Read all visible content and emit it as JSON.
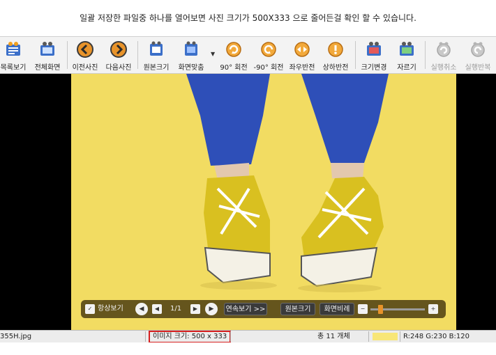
{
  "caption": "일괄 저장한 파일중 하나를 열어보면  사진 크기가  500X333 으로 줄어든걸 확인 할 수 있습니다.",
  "toolbar": {
    "buttons": [
      {
        "label": "목록보기",
        "icon": "list-view-icon"
      },
      {
        "label": "전체화면",
        "icon": "fullscreen-icon"
      },
      {
        "label": "이전사진",
        "icon": "previous-arrow-icon"
      },
      {
        "label": "다음사진",
        "icon": "next-arrow-icon"
      },
      {
        "label": "원본크기",
        "icon": "original-size-icon"
      },
      {
        "label": "화면맞춤",
        "icon": "fit-screen-icon"
      },
      {
        "label": "90° 회전",
        "icon": "rotate-cw-icon"
      },
      {
        "label": "-90° 회전",
        "icon": "rotate-ccw-icon"
      },
      {
        "label": "좌우반전",
        "icon": "flip-horizontal-icon"
      },
      {
        "label": "상하반전",
        "icon": "flip-vertical-icon"
      },
      {
        "label": "크기변경",
        "icon": "resize-icon"
      },
      {
        "label": "자르기",
        "icon": "crop-icon"
      },
      {
        "label": "실행취소",
        "icon": "undo-icon"
      },
      {
        "label": "실행반복",
        "icon": "redo-icon"
      }
    ]
  },
  "controlbar": {
    "always_view_label": "항상보기",
    "page_indicator": "1/1",
    "slideshow_label": "연속보기 >>",
    "original_size_label": "원본크기",
    "screen_ratio_label": "화면비례",
    "minus": "−",
    "plus": "+"
  },
  "status": {
    "filename": "355H.jpg",
    "image_size": "이미지 크기: 500 x 333",
    "total_count": "총 11 개체",
    "rgb": "R:248 G:230 B:120",
    "swatch_color": "#f8e678"
  },
  "colors": {
    "background_yellow": "#f2dc62",
    "pants_blue": "#2e4fb8",
    "highlight_red": "#d62020"
  }
}
